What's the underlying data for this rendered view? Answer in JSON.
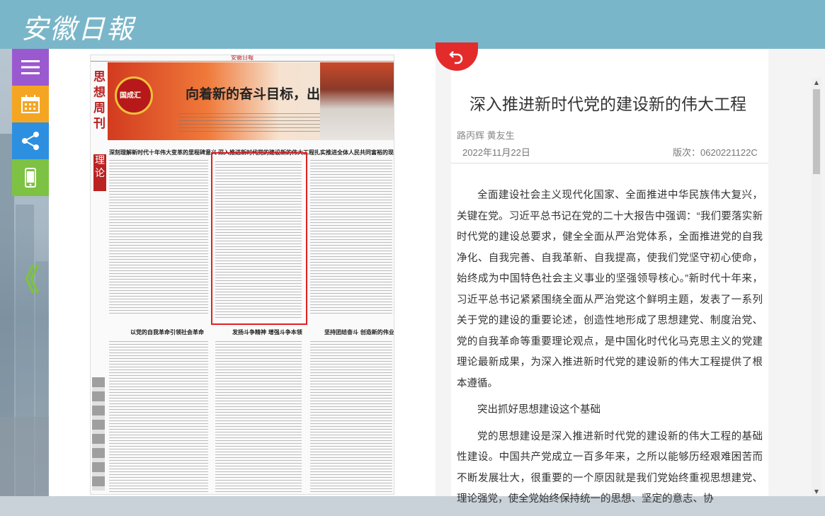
{
  "header": {
    "logo_text": "安徽日報"
  },
  "sidebar": {
    "items": [
      {
        "name": "menu",
        "icon": "menu-icon",
        "color": "#9b59d0"
      },
      {
        "name": "calendar",
        "icon": "calendar-icon",
        "color": "#f4a623"
      },
      {
        "name": "share",
        "icon": "share-icon",
        "color": "#2d8fe0"
      },
      {
        "name": "mobile",
        "icon": "mobile-icon",
        "color": "#7dc242"
      }
    ],
    "back_glyph": "《"
  },
  "paper": {
    "masthead": "安徽日報",
    "section_vertical": "思想周刊",
    "section_red": "理论",
    "banner_logo": "国成汇",
    "banner_title": "向着新的奋斗目标，出发！",
    "headlines": [
      "深刻理解新时代十年伟大变革的里程碑意义",
      "深入推进新时代党的建设新的伟大工程",
      "扎实推进全体人民共同富裕的现代化",
      "以党的自我革命引领社会革命",
      "发扬斗争精神 增强斗争本领",
      "坚持团结奋斗 创造新的伟业"
    ]
  },
  "article": {
    "title": "深入推进新时代党的建设新的伟大工程",
    "authors": "路丙辉 黄友生",
    "date": "2022年11月22日",
    "version": "版次：0620221122C",
    "paragraphs": [
      "全面建设社会主义现代化国家、全面推进中华民族伟大复兴，关键在党。习近平总书记在党的二十大报告中强调：“我们要落实新时代党的建设总要求，健全全面从严治党体系，全面推进党的自我净化、自我完善、自我革新、自我提高，使我们党坚守初心使命，始终成为中国特色社会主义事业的坚强领导核心。”新时代十年来，习近平总书记紧紧围绕全面从严治党这个鲜明主题，发表了一系列关于党的建设的重要论述，创造性地形成了思想建党、制度治党、党的自我革命等重要理论观点，是中国化时代化马克思主义的党建理论最新成果，为深入推进新时代党的建设新的伟大工程提供了根本遵循。",
      "突出抓好思想建设这个基础",
      "党的思想建设是深入推进新时代党的建设新的伟大工程的基础性建设。中国共产党成立一百多年来，之所以能够历经艰难困苦而不断发展壮大，很重要的一个原因就是我们党始终重视思想建党、理论强党，使全党始终保持统一的思想、坚定的意志、协"
    ]
  },
  "colors": {
    "header": "#7ab6c9",
    "return_button": "#e32b2b",
    "highlight_box": "#e02020"
  }
}
